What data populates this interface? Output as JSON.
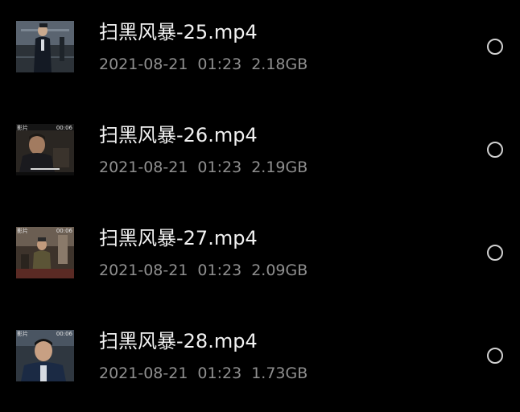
{
  "files": [
    {
      "name": "扫黑风暴-25.mp4",
      "date": "2021-08-21",
      "time": "01:23",
      "size": "2.18GB",
      "thumbnail_duration": "",
      "thumbnail_tag": "",
      "selected": false
    },
    {
      "name": "扫黑风暴-26.mp4",
      "date": "2021-08-21",
      "time": "01:23",
      "size": "2.19GB",
      "thumbnail_duration": "00:06",
      "thumbnail_tag": "影片",
      "selected": false
    },
    {
      "name": "扫黑风暴-27.mp4",
      "date": "2021-08-21",
      "time": "01:23",
      "size": "2.09GB",
      "thumbnail_duration": "00:06",
      "thumbnail_tag": "影片",
      "selected": false
    },
    {
      "name": "扫黑风暴-28.mp4",
      "date": "2021-08-21",
      "time": "01:23",
      "size": "1.73GB",
      "thumbnail_duration": "00:06",
      "thumbnail_tag": "影片",
      "selected": false
    }
  ],
  "colors": {
    "background": "#000000",
    "title_text": "#f2f2f2",
    "meta_text": "#8f8f8f",
    "radio_border": "#d0d0d0"
  }
}
